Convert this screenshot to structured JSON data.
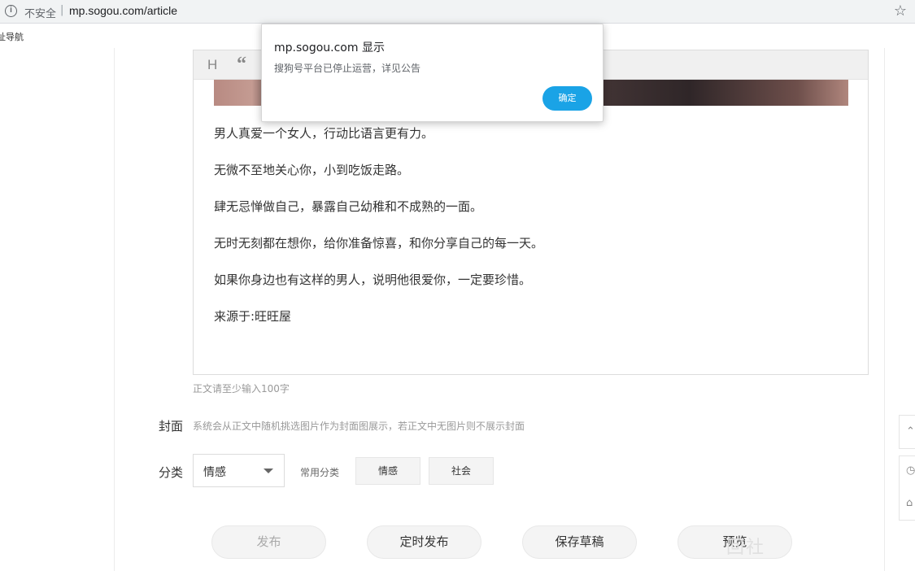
{
  "browser": {
    "insecure_label": "不安全",
    "separator": "|",
    "url": "mp.sogou.com/article",
    "bookmark_item": "址导航"
  },
  "editor": {
    "toolbar": {
      "heading_label": "H",
      "quote_label": "“"
    },
    "paragraphs": [
      "男人真爱一个女人，行动比语言更有力。",
      "无微不至地关心你，小到吃饭走路。",
      "肆无忌惮做自己，暴露自己幼稚和不成熟的一面。",
      "无时无刻都在想你，给你准备惊喜，和你分享自己的每一天。",
      "如果你身边也有这样的男人，说明他很爱你，一定要珍惜。",
      "来源于:旺旺屋"
    ],
    "hint": "正文请至少输入100字"
  },
  "cover": {
    "label": "封面",
    "description": "系统会从正文中随机挑选图片作为封面图展示，若正文中无图片则不展示封面"
  },
  "category": {
    "label": "分类",
    "selected": "情感",
    "common_label": "常用分类",
    "tags": [
      "情感",
      "社会"
    ]
  },
  "actions": {
    "publish": "发布",
    "schedule": "定时发布",
    "save_draft": "保存草稿",
    "preview": "预览"
  },
  "watermark": "回社",
  "dialog": {
    "title": "mp.sogou.com 显示",
    "message": "搜狗号平台已停止运营，详见公告",
    "ok": "确定"
  },
  "colors": {
    "accent": "#1aa3e6"
  }
}
